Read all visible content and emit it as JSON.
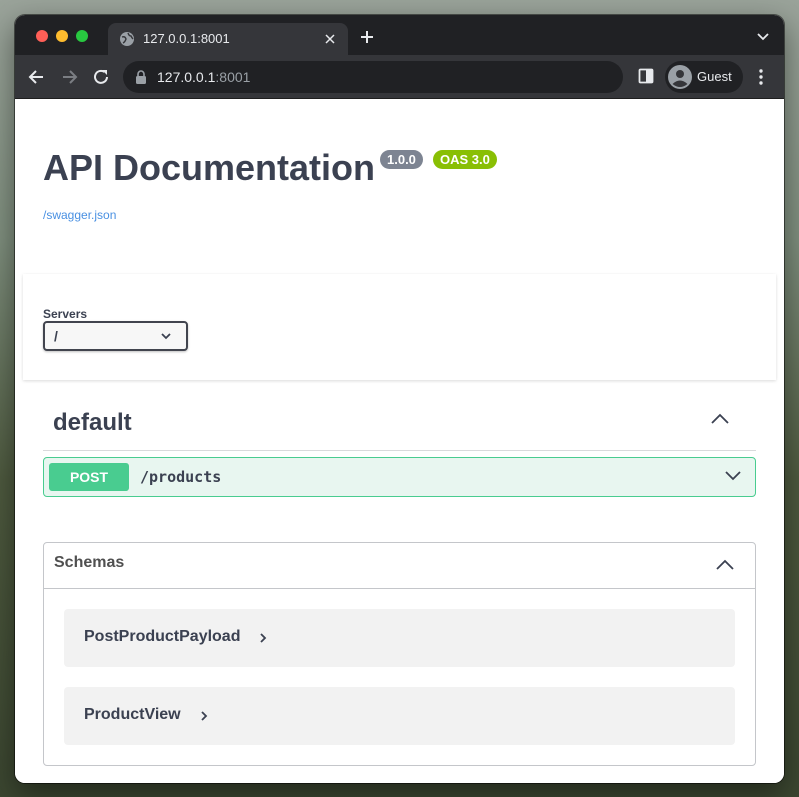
{
  "browser": {
    "tab_title": "127.0.0.1:8001",
    "url_host": "127.0.0.1",
    "url_port": ":8001",
    "profile_label": "Guest"
  },
  "info": {
    "title": "API Documentation",
    "version_badge": "1.0.0",
    "oas_badge": "OAS 3.0",
    "spec_link": "/swagger.json"
  },
  "servers": {
    "label": "Servers",
    "selected": "/"
  },
  "tag": {
    "name": "default"
  },
  "operation": {
    "method": "POST",
    "path": "/products"
  },
  "schemas": {
    "title": "Schemas",
    "items": [
      {
        "name": "PostProductPayload"
      },
      {
        "name": "ProductView"
      }
    ]
  },
  "colors": {
    "post_method": "#49cc90",
    "post_bg": "#e8f6f0",
    "oas_badge": "#89bf04",
    "version_badge": "#7d8492",
    "link": "#4990e2"
  }
}
